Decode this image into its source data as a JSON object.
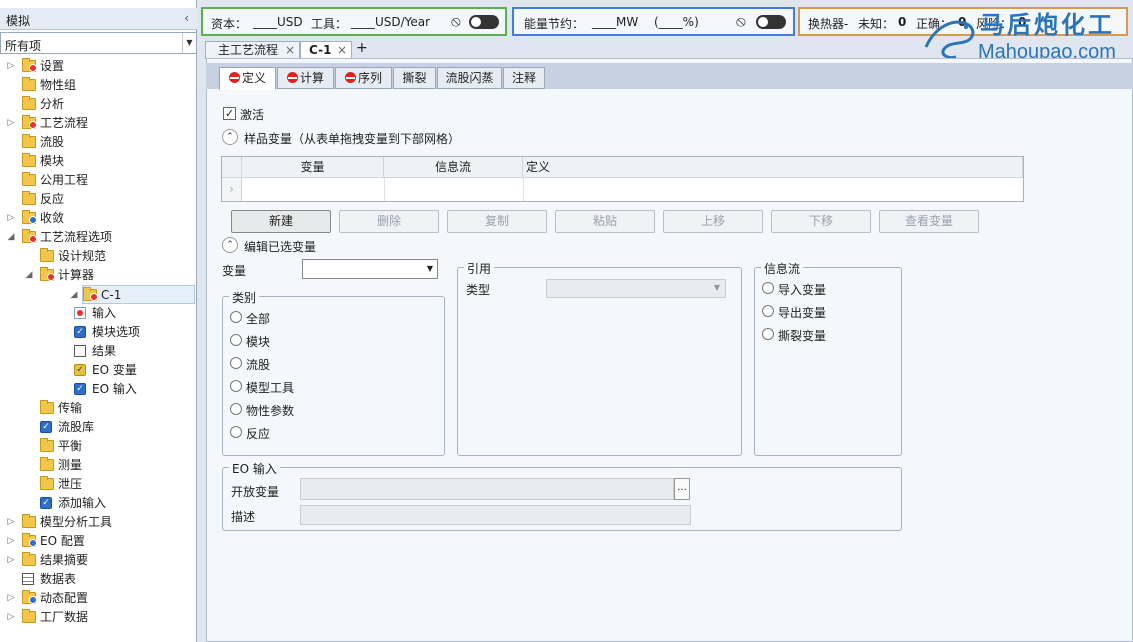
{
  "left_panel": {
    "title": "模拟",
    "collapse_glyph": "‹",
    "filter_value": "所有项",
    "tree": [
      {
        "label": "设置",
        "icon": "folder-red",
        "level": 0,
        "expander": "▷"
      },
      {
        "label": "物性组",
        "icon": "folder",
        "level": 0,
        "expander": ""
      },
      {
        "label": "分析",
        "icon": "folder",
        "level": 0,
        "expander": ""
      },
      {
        "label": "工艺流程",
        "icon": "folder-red",
        "level": 0,
        "expander": "▷"
      },
      {
        "label": "流股",
        "icon": "folder",
        "level": 0,
        "expander": ""
      },
      {
        "label": "模块",
        "icon": "folder",
        "level": 0,
        "expander": ""
      },
      {
        "label": "公用工程",
        "icon": "folder",
        "level": 0,
        "expander": ""
      },
      {
        "label": "反应",
        "icon": "folder",
        "level": 0,
        "expander": ""
      },
      {
        "label": "收敛",
        "icon": "folder-check",
        "level": 0,
        "expander": "▷"
      },
      {
        "label": "工艺流程选项",
        "icon": "folder-red",
        "level": 0,
        "expander": "◢"
      },
      {
        "label": "设计规范",
        "icon": "folder",
        "level": 1,
        "expander": ""
      },
      {
        "label": "计算器",
        "icon": "folder-red",
        "level": 1,
        "expander": "◢"
      },
      {
        "label": "C-1",
        "icon": "folder-red",
        "level": 2,
        "expander": "◢"
      },
      {
        "label": "输入",
        "icon": "red-form",
        "level": 3,
        "expander": ""
      },
      {
        "label": "模块选项",
        "icon": "check",
        "level": 3,
        "expander": ""
      },
      {
        "label": "结果",
        "icon": "results",
        "level": 3,
        "expander": ""
      },
      {
        "label": "EO 变量",
        "icon": "check-yellow",
        "level": 3,
        "expander": ""
      },
      {
        "label": "EO 输入",
        "icon": "check",
        "level": 3,
        "expander": ""
      },
      {
        "label": "传输",
        "icon": "folder",
        "level": 1,
        "expander": ""
      },
      {
        "label": "流股库",
        "icon": "check",
        "level": 1,
        "expander": ""
      },
      {
        "label": "平衡",
        "icon": "folder",
        "level": 1,
        "expander": ""
      },
      {
        "label": "测量",
        "icon": "folder",
        "level": 1,
        "expander": ""
      },
      {
        "label": "泄压",
        "icon": "folder",
        "level": 1,
        "expander": ""
      },
      {
        "label": "添加输入",
        "icon": "check",
        "level": 1,
        "expander": ""
      },
      {
        "label": "模型分析工具",
        "icon": "folder",
        "level": 0,
        "expander": "▷"
      },
      {
        "label": "EO 配置",
        "icon": "folder-check",
        "level": 0,
        "expander": "▷"
      },
      {
        "label": "结果摘要",
        "icon": "folder",
        "level": 0,
        "expander": "▷"
      },
      {
        "label": "数据表",
        "icon": "table",
        "level": 0,
        "expander": ""
      },
      {
        "label": "动态配置",
        "icon": "folder-check",
        "level": 0,
        "expander": "▷"
      },
      {
        "label": "工厂数据",
        "icon": "folder",
        "level": 0,
        "expander": "▷"
      }
    ]
  },
  "toolbar": {
    "cost": {
      "capital_label": "资本：",
      "capital_value": "____USD",
      "tool_label": "工具：",
      "tool_value": "____USD/Year"
    },
    "energy": {
      "label": "能量节约：",
      "value": "____MW",
      "percent": "(____%)"
    },
    "heat_exchanger": {
      "label": "换热器-",
      "unknown_label": "未知：",
      "unknown_value": "0",
      "correct_label": "正确：",
      "correct_value": "0",
      "risk_label": "风险：",
      "risk_value": "0"
    }
  },
  "watermark": {
    "chinese": "马后炮化工",
    "url": "Mahoupao.com"
  },
  "doc_tabs": [
    {
      "label": "主工艺流程",
      "active": false
    },
    {
      "label": "C-1",
      "active": true
    }
  ],
  "doc_tab_add": "+",
  "doc_tab_close": "×",
  "sub_tabs": [
    {
      "label": "定义",
      "status": "red",
      "active": true
    },
    {
      "label": "计算",
      "status": "red",
      "active": false
    },
    {
      "label": "序列",
      "status": "red",
      "active": false
    },
    {
      "label": "撕裂",
      "status": "",
      "active": false
    },
    {
      "label": "流股闪蒸",
      "status": "",
      "active": false
    },
    {
      "label": "注释",
      "status": "",
      "active": false
    }
  ],
  "form": {
    "active_label": "激活",
    "active_checked": "✓",
    "sampled_section": "样品变量（从表单拖拽变量到下部网格）",
    "grid_headers": [
      "变量",
      "信息流",
      "定义"
    ],
    "grid_row_marker": "›",
    "buttons": [
      {
        "label": "新建",
        "enabled": true
      },
      {
        "label": "删除",
        "enabled": false
      },
      {
        "label": "复制",
        "enabled": false
      },
      {
        "label": "粘贴",
        "enabled": false
      },
      {
        "label": "上移",
        "enabled": false
      },
      {
        "label": "下移",
        "enabled": false
      },
      {
        "label": "查看变量",
        "enabled": false
      }
    ],
    "edit_section": "编辑已选变量",
    "variable_label": "变量",
    "variable_value": "",
    "category_group": "类别",
    "category_options": [
      "全部",
      "模块",
      "流股",
      "模型工具",
      "物性参数",
      "反应"
    ],
    "reference_group": "引用",
    "type_label": "类型",
    "type_value": "",
    "infoflow_group": "信息流",
    "infoflow_options": [
      "导入变量",
      "导出变量",
      "撕裂变量"
    ],
    "eo_group": "EO 输入",
    "open_variable_label": "开放变量",
    "open_variable_value": "",
    "browse_glyph": "...",
    "description_label": "描述",
    "description_value": ""
  }
}
